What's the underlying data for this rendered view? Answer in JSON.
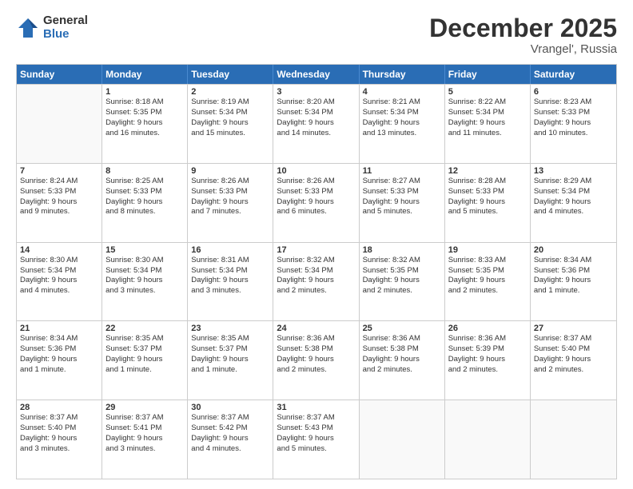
{
  "logo": {
    "general": "General",
    "blue": "Blue"
  },
  "header": {
    "month": "December 2025",
    "location": "Vrangel', Russia"
  },
  "weekdays": [
    "Sunday",
    "Monday",
    "Tuesday",
    "Wednesday",
    "Thursday",
    "Friday",
    "Saturday"
  ],
  "weeks": [
    [
      {
        "day": "",
        "info": ""
      },
      {
        "day": "1",
        "info": "Sunrise: 8:18 AM\nSunset: 5:35 PM\nDaylight: 9 hours\nand 16 minutes."
      },
      {
        "day": "2",
        "info": "Sunrise: 8:19 AM\nSunset: 5:34 PM\nDaylight: 9 hours\nand 15 minutes."
      },
      {
        "day": "3",
        "info": "Sunrise: 8:20 AM\nSunset: 5:34 PM\nDaylight: 9 hours\nand 14 minutes."
      },
      {
        "day": "4",
        "info": "Sunrise: 8:21 AM\nSunset: 5:34 PM\nDaylight: 9 hours\nand 13 minutes."
      },
      {
        "day": "5",
        "info": "Sunrise: 8:22 AM\nSunset: 5:34 PM\nDaylight: 9 hours\nand 11 minutes."
      },
      {
        "day": "6",
        "info": "Sunrise: 8:23 AM\nSunset: 5:33 PM\nDaylight: 9 hours\nand 10 minutes."
      }
    ],
    [
      {
        "day": "7",
        "info": "Sunrise: 8:24 AM\nSunset: 5:33 PM\nDaylight: 9 hours\nand 9 minutes."
      },
      {
        "day": "8",
        "info": "Sunrise: 8:25 AM\nSunset: 5:33 PM\nDaylight: 9 hours\nand 8 minutes."
      },
      {
        "day": "9",
        "info": "Sunrise: 8:26 AM\nSunset: 5:33 PM\nDaylight: 9 hours\nand 7 minutes."
      },
      {
        "day": "10",
        "info": "Sunrise: 8:26 AM\nSunset: 5:33 PM\nDaylight: 9 hours\nand 6 minutes."
      },
      {
        "day": "11",
        "info": "Sunrise: 8:27 AM\nSunset: 5:33 PM\nDaylight: 9 hours\nand 5 minutes."
      },
      {
        "day": "12",
        "info": "Sunrise: 8:28 AM\nSunset: 5:33 PM\nDaylight: 9 hours\nand 5 minutes."
      },
      {
        "day": "13",
        "info": "Sunrise: 8:29 AM\nSunset: 5:34 PM\nDaylight: 9 hours\nand 4 minutes."
      }
    ],
    [
      {
        "day": "14",
        "info": "Sunrise: 8:30 AM\nSunset: 5:34 PM\nDaylight: 9 hours\nand 4 minutes."
      },
      {
        "day": "15",
        "info": "Sunrise: 8:30 AM\nSunset: 5:34 PM\nDaylight: 9 hours\nand 3 minutes."
      },
      {
        "day": "16",
        "info": "Sunrise: 8:31 AM\nSunset: 5:34 PM\nDaylight: 9 hours\nand 3 minutes."
      },
      {
        "day": "17",
        "info": "Sunrise: 8:32 AM\nSunset: 5:34 PM\nDaylight: 9 hours\nand 2 minutes."
      },
      {
        "day": "18",
        "info": "Sunrise: 8:32 AM\nSunset: 5:35 PM\nDaylight: 9 hours\nand 2 minutes."
      },
      {
        "day": "19",
        "info": "Sunrise: 8:33 AM\nSunset: 5:35 PM\nDaylight: 9 hours\nand 2 minutes."
      },
      {
        "day": "20",
        "info": "Sunrise: 8:34 AM\nSunset: 5:36 PM\nDaylight: 9 hours\nand 1 minute."
      }
    ],
    [
      {
        "day": "21",
        "info": "Sunrise: 8:34 AM\nSunset: 5:36 PM\nDaylight: 9 hours\nand 1 minute."
      },
      {
        "day": "22",
        "info": "Sunrise: 8:35 AM\nSunset: 5:37 PM\nDaylight: 9 hours\nand 1 minute."
      },
      {
        "day": "23",
        "info": "Sunrise: 8:35 AM\nSunset: 5:37 PM\nDaylight: 9 hours\nand 1 minute."
      },
      {
        "day": "24",
        "info": "Sunrise: 8:36 AM\nSunset: 5:38 PM\nDaylight: 9 hours\nand 2 minutes."
      },
      {
        "day": "25",
        "info": "Sunrise: 8:36 AM\nSunset: 5:38 PM\nDaylight: 9 hours\nand 2 minutes."
      },
      {
        "day": "26",
        "info": "Sunrise: 8:36 AM\nSunset: 5:39 PM\nDaylight: 9 hours\nand 2 minutes."
      },
      {
        "day": "27",
        "info": "Sunrise: 8:37 AM\nSunset: 5:40 PM\nDaylight: 9 hours\nand 2 minutes."
      }
    ],
    [
      {
        "day": "28",
        "info": "Sunrise: 8:37 AM\nSunset: 5:40 PM\nDaylight: 9 hours\nand 3 minutes."
      },
      {
        "day": "29",
        "info": "Sunrise: 8:37 AM\nSunset: 5:41 PM\nDaylight: 9 hours\nand 3 minutes."
      },
      {
        "day": "30",
        "info": "Sunrise: 8:37 AM\nSunset: 5:42 PM\nDaylight: 9 hours\nand 4 minutes."
      },
      {
        "day": "31",
        "info": "Sunrise: 8:37 AM\nSunset: 5:43 PM\nDaylight: 9 hours\nand 5 minutes."
      },
      {
        "day": "",
        "info": ""
      },
      {
        "day": "",
        "info": ""
      },
      {
        "day": "",
        "info": ""
      }
    ]
  ]
}
